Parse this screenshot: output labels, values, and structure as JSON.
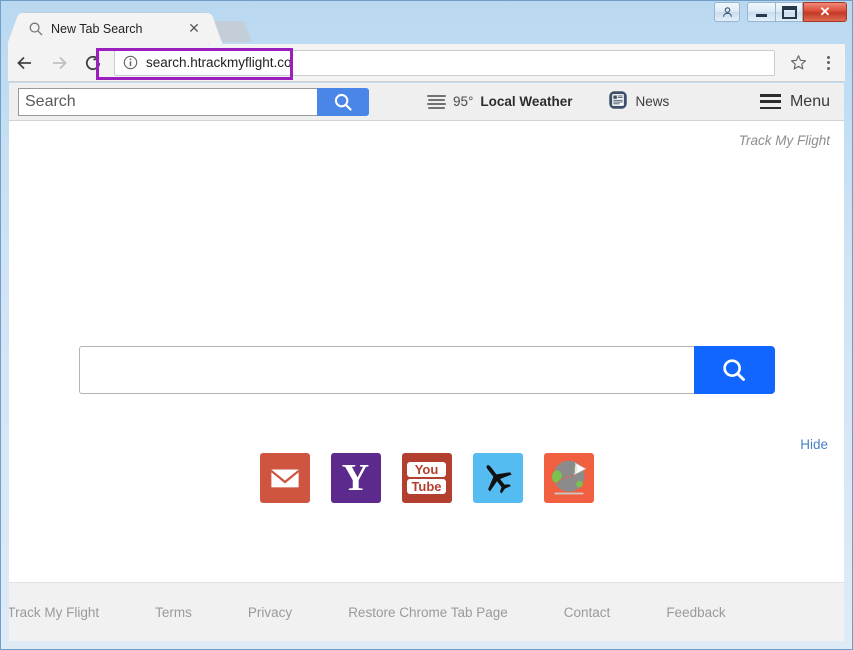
{
  "window": {
    "controls": [
      {
        "name": "user-account-button",
        "glyph": "A"
      },
      {
        "name": "minimize-button",
        "glyph": ""
      },
      {
        "name": "maximize-button",
        "glyph": ""
      },
      {
        "name": "close-button",
        "glyph": "✕"
      }
    ]
  },
  "browser": {
    "tab": {
      "title": "New Tab Search",
      "close_label": "✕",
      "favicon": "search-icon"
    },
    "new_tab_button_label": "",
    "nav": {
      "back_label": "←",
      "forward_label": "→",
      "reload_label": "↻",
      "url": "search.htrackmyflight.co",
      "security_icon": "info-circle-icon",
      "bookmark_icon": "star-icon",
      "menu_icon": "three-dot-menu-icon"
    }
  },
  "ext_toolbar": {
    "search_placeholder": "Search",
    "search_value": "",
    "search_button_icon": "search-icon",
    "weather": {
      "icon": "fog-icon",
      "temperature": "95°",
      "label": "Local Weather"
    },
    "news": {
      "icon": "newspaper-icon",
      "label": "News"
    },
    "menu": {
      "icon": "hamburger-icon",
      "label": "Menu"
    }
  },
  "page": {
    "brand": "Track My Flight",
    "search": {
      "value": "",
      "placeholder": "",
      "button_icon": "search-icon"
    },
    "hide_label": "Hide",
    "shortcuts": [
      {
        "name": "shortcut-gmail",
        "label": "Gmail",
        "color": "#cf5540"
      },
      {
        "name": "shortcut-yahoo",
        "label": "Yahoo",
        "color": "#5b2a8c"
      },
      {
        "name": "shortcut-youtube",
        "label": "YouTube",
        "color": "#b3402f"
      },
      {
        "name": "shortcut-flight",
        "label": "Flight Tracker",
        "color": "#54bcf0"
      },
      {
        "name": "shortcut-globe",
        "label": "Track My Flight",
        "color": "#f06040"
      }
    ],
    "footer_links": [
      "Track My Flight",
      "Terms",
      "Privacy",
      "Restore Chrome Tab Page",
      "Contact",
      "Feedback"
    ]
  },
  "annotation": {
    "highlight_color": "#9b1fbf",
    "target": "search.htrackmyflight.co"
  },
  "colors": {
    "ext_search_button": "#4a86e8",
    "main_search_button": "#1166ff",
    "hide_link": "#4a83c4",
    "footer_link": "#9a9a9a"
  }
}
